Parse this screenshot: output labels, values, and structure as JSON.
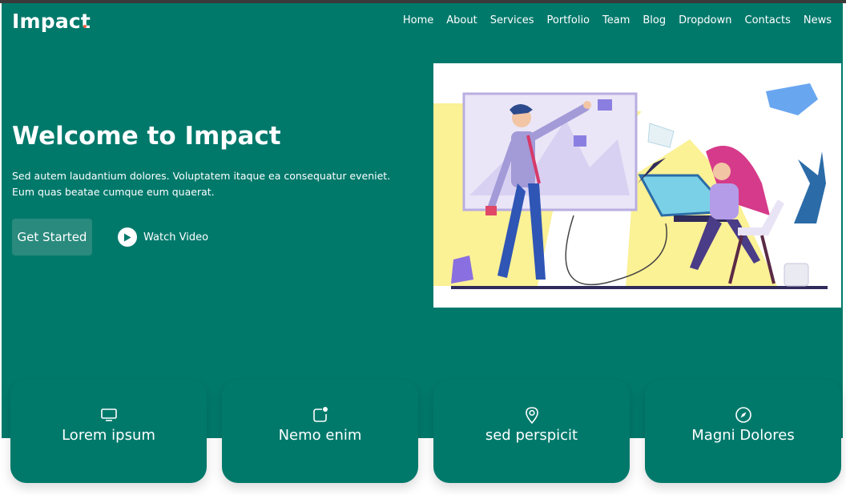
{
  "brand": {
    "name": "Impact",
    "accent_color": "#f85a40"
  },
  "nav": {
    "items": [
      "Home",
      "About",
      "Services",
      "Portfolio",
      "Team",
      "Blog",
      "Dropdown",
      "Contacts",
      "News"
    ]
  },
  "hero": {
    "title": "Welcome to Impact",
    "text": "Sed autem laudantium dolores. Voluptatem itaque ea consequatur eveniet. Eum quas beatae cumque eum quaerat.",
    "primary_button": "Get Started",
    "video_link": "Watch Video",
    "background_color": "#00796b"
  },
  "cards": [
    {
      "title": "Lorem ipsum",
      "icon": "monitor-icon"
    },
    {
      "title": "Nemo enim",
      "icon": "notification-icon"
    },
    {
      "title": "sed perspicit",
      "icon": "location-pin-icon"
    },
    {
      "title": "Magni Dolores",
      "icon": "compass-icon"
    }
  ]
}
